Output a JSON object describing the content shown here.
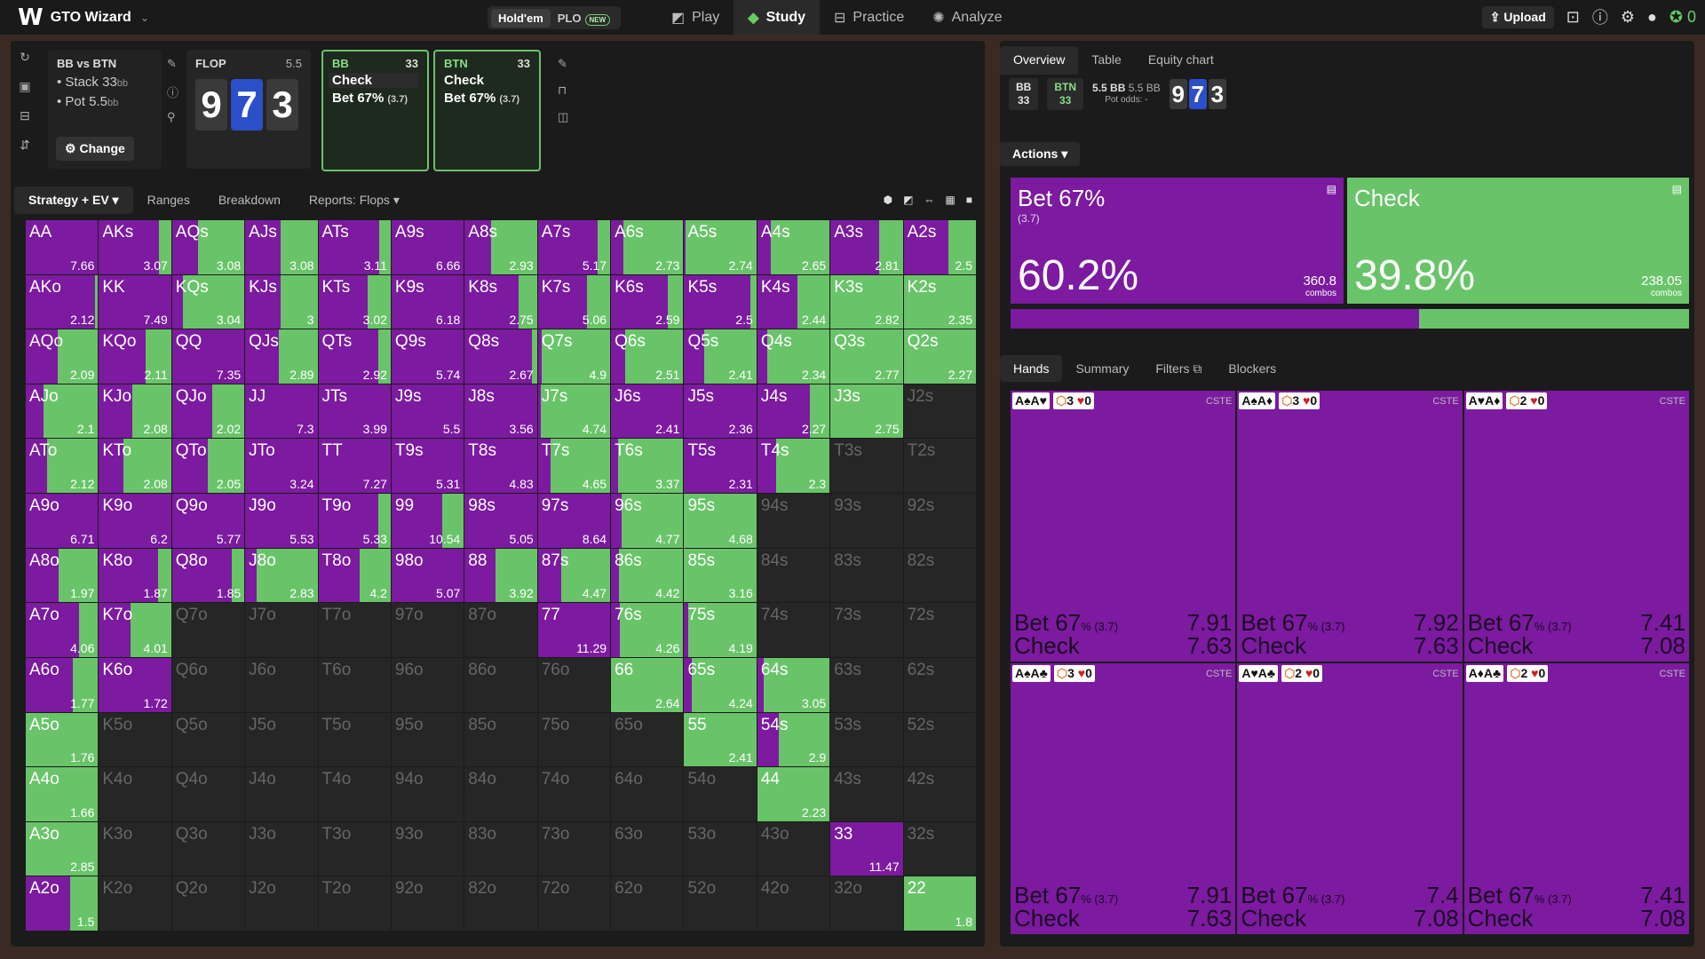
{
  "topbar": {
    "logo_letter": "W",
    "app_title": "GTO Wizard",
    "game_modes": [
      "Hold'em",
      "PLO"
    ],
    "new_badge": "NEW",
    "nav": [
      "Play",
      "Study",
      "Practice",
      "Analyze"
    ],
    "upload_label": "Upload",
    "credits": "0"
  },
  "spot": {
    "title": "BB vs BTN",
    "stack_label": "Stack 33",
    "stack_unit": "bb",
    "pot_label": "Pot 5.5",
    "pot_unit": "bb",
    "change_label": "Change"
  },
  "flop": {
    "label": "FLOP",
    "pot": "5.5",
    "cards": [
      {
        "rank": "9",
        "color": "#3a3a3a"
      },
      {
        "rank": "7",
        "color": "#2b4fc9"
      },
      {
        "rank": "3",
        "color": "#3a3a3a"
      }
    ]
  },
  "action_cards": [
    {
      "player": "BB",
      "stack": "33",
      "lines": [
        {
          "label": "Check",
          "extra": ""
        },
        {
          "label": "Bet 67%",
          "extra": "(3.7)"
        }
      ]
    },
    {
      "player": "BTN",
      "stack": "33",
      "lines": [
        {
          "label": "Check",
          "extra": ""
        },
        {
          "label": "Bet 67%",
          "extra": "(3.7)"
        }
      ]
    }
  ],
  "left_tabs": [
    "Strategy + EV",
    "Ranges",
    "Breakdown",
    "Reports: Flops"
  ],
  "colors": {
    "bet": "#7c1aa0",
    "check": "#69c469",
    "empty": "#262626"
  },
  "matrix": [
    [
      [
        "AA",
        100,
        7.66
      ],
      [
        "AKs",
        83,
        3.07
      ],
      [
        "AQs",
        36,
        3.08
      ],
      [
        "AJs",
        49,
        3.08
      ],
      [
        "ATs",
        84,
        3.11
      ],
      [
        "A9s",
        100,
        6.66
      ],
      [
        "A8s",
        36,
        2.93
      ],
      [
        "A7s",
        83,
        5.17
      ],
      [
        "A6s",
        17,
        2.73
      ],
      [
        "A5s",
        2,
        2.74
      ],
      [
        "A4s",
        19,
        2.65
      ],
      [
        "A3s",
        67,
        2.81
      ],
      [
        "A2s",
        62,
        2.5
      ]
    ],
    [
      [
        "AKo",
        96,
        2.12
      ],
      [
        "KK",
        100,
        7.49
      ],
      [
        "KQs",
        15,
        3.04
      ],
      [
        "KJs",
        49,
        3
      ],
      [
        "KTs",
        68,
        3.02
      ],
      [
        "K9s",
        100,
        6.18
      ],
      [
        "K8s",
        74,
        2.75
      ],
      [
        "K7s",
        68,
        5.06
      ],
      [
        "K6s",
        79,
        2.59
      ],
      [
        "K5s",
        92,
        2.5
      ],
      [
        "K4s",
        56,
        2.44
      ],
      [
        "K3s",
        0,
        2.82
      ],
      [
        "K2s",
        0,
        2.35
      ]
    ],
    [
      [
        "AQo",
        44,
        2.09
      ],
      [
        "KQo",
        65,
        2.11
      ],
      [
        "QQ",
        100,
        7.35
      ],
      [
        "QJs",
        47,
        2.89
      ],
      [
        "QTs",
        83,
        2.92
      ],
      [
        "Q9s",
        100,
        5.74
      ],
      [
        "Q8s",
        93,
        2.67
      ],
      [
        "Q7s",
        5,
        4.9
      ],
      [
        "Q6s",
        19,
        2.51
      ],
      [
        "Q5s",
        28,
        2.41
      ],
      [
        "Q4s",
        14,
        2.34
      ],
      [
        "Q3s",
        0,
        2.77
      ],
      [
        "Q2s",
        0,
        2.27
      ]
    ],
    [
      [
        "AJo",
        25,
        2.1
      ],
      [
        "KJo",
        46,
        2.08
      ],
      [
        "QJo",
        55,
        2.02
      ],
      [
        "JJ",
        100,
        7.3
      ],
      [
        "JTs",
        100,
        3.99
      ],
      [
        "J9s",
        100,
        5.5
      ],
      [
        "J8s",
        100,
        3.56
      ],
      [
        "J7s",
        4,
        4.74
      ],
      [
        "J6s",
        100,
        2.41
      ],
      [
        "J5s",
        100,
        2.36
      ],
      [
        "J4s",
        73,
        2.27
      ],
      [
        "J3s",
        0,
        2.75
      ],
      [
        "J2s",
        -1,
        0
      ]
    ],
    [
      [
        "ATo",
        29,
        2.12
      ],
      [
        "KTo",
        34,
        2.08
      ],
      [
        "QTo",
        50,
        2.05
      ],
      [
        "JTo",
        100,
        3.24
      ],
      [
        "TT",
        100,
        7.27
      ],
      [
        "T9s",
        100,
        5.31
      ],
      [
        "T8s",
        100,
        4.83
      ],
      [
        "T7s",
        17,
        4.65
      ],
      [
        "T6s",
        10,
        3.37
      ],
      [
        "T5s",
        100,
        2.31
      ],
      [
        "T4s",
        26,
        2.3
      ],
      [
        "T3s",
        -1,
        0
      ],
      [
        "T2s",
        -1,
        0
      ]
    ],
    [
      [
        "A9o",
        100,
        6.71
      ],
      [
        "K9o",
        100,
        6.2
      ],
      [
        "Q9o",
        100,
        5.77
      ],
      [
        "J9o",
        100,
        5.53
      ],
      [
        "T9o",
        83,
        5.33
      ],
      [
        "99",
        70,
        10.54
      ],
      [
        "98s",
        100,
        5.05
      ],
      [
        "97s",
        100,
        8.64
      ],
      [
        "96s",
        15,
        4.77
      ],
      [
        "95s",
        0,
        4.68
      ],
      [
        "94s",
        -1,
        0
      ],
      [
        "93s",
        -1,
        0
      ],
      [
        "92s",
        -1,
        0
      ]
    ],
    [
      [
        "A8o",
        45,
        1.97
      ],
      [
        "K8o",
        82,
        1.87
      ],
      [
        "Q8o",
        83,
        1.85
      ],
      [
        "J8o",
        16,
        2.83
      ],
      [
        "T8o",
        57,
        4.2
      ],
      [
        "98o",
        100,
        5.07
      ],
      [
        "88",
        43,
        3.92
      ],
      [
        "87s",
        32,
        4.47
      ],
      [
        "86s",
        11,
        4.42
      ],
      [
        "85s",
        0,
        3.16
      ],
      [
        "84s",
        -1,
        0
      ],
      [
        "83s",
        -1,
        0
      ],
      [
        "82s",
        -1,
        0
      ]
    ],
    [
      [
        "A7o",
        74,
        4.06
      ],
      [
        "K7o",
        44,
        4.01
      ],
      [
        "Q7o",
        -1,
        0
      ],
      [
        "J7o",
        -1,
        0
      ],
      [
        "T7o",
        -1,
        0
      ],
      [
        "97o",
        -1,
        0
      ],
      [
        "87o",
        -1,
        0
      ],
      [
        "77",
        100,
        11.29
      ],
      [
        "76s",
        12,
        4.26
      ],
      [
        "75s",
        6,
        4.19
      ],
      [
        "74s",
        -1,
        0
      ],
      [
        "73s",
        -1,
        0
      ],
      [
        "72s",
        -1,
        0
      ]
    ],
    [
      [
        "A6o",
        65,
        1.77
      ],
      [
        "K6o",
        100,
        1.72
      ],
      [
        "Q6o",
        -1,
        0
      ],
      [
        "J6o",
        -1,
        0
      ],
      [
        "T6o",
        -1,
        0
      ],
      [
        "96o",
        -1,
        0
      ],
      [
        "86o",
        -1,
        0
      ],
      [
        "76o",
        -1,
        0
      ],
      [
        "66",
        0,
        2.64
      ],
      [
        "65s",
        10,
        4.24
      ],
      [
        "64s",
        9,
        3.05
      ],
      [
        "63s",
        -1,
        0
      ],
      [
        "62s",
        -1,
        0
      ]
    ],
    [
      [
        "A5o",
        0,
        1.76
      ],
      [
        "K5o",
        -1,
        0
      ],
      [
        "Q5o",
        -1,
        0
      ],
      [
        "J5o",
        -1,
        0
      ],
      [
        "T5o",
        -1,
        0
      ],
      [
        "95o",
        -1,
        0
      ],
      [
        "85o",
        -1,
        0
      ],
      [
        "75o",
        -1,
        0
      ],
      [
        "65o",
        -1,
        0
      ],
      [
        "55",
        0,
        2.41
      ],
      [
        "54s",
        30,
        2.9
      ],
      [
        "53s",
        -1,
        0
      ],
      [
        "52s",
        -1,
        0
      ]
    ],
    [
      [
        "A4o",
        0,
        1.66
      ],
      [
        "K4o",
        -1,
        0
      ],
      [
        "Q4o",
        -1,
        0
      ],
      [
        "J4o",
        -1,
        0
      ],
      [
        "T4o",
        -1,
        0
      ],
      [
        "94o",
        -1,
        0
      ],
      [
        "84o",
        -1,
        0
      ],
      [
        "74o",
        -1,
        0
      ],
      [
        "64o",
        -1,
        0
      ],
      [
        "54o",
        -1,
        0
      ],
      [
        "44",
        0,
        2.23
      ],
      [
        "43s",
        -1,
        0
      ],
      [
        "42s",
        -1,
        0
      ]
    ],
    [
      [
        "A3o",
        0,
        2.85
      ],
      [
        "K3o",
        -1,
        0
      ],
      [
        "Q3o",
        -1,
        0
      ],
      [
        "J3o",
        -1,
        0
      ],
      [
        "T3o",
        -1,
        0
      ],
      [
        "93o",
        -1,
        0
      ],
      [
        "83o",
        -1,
        0
      ],
      [
        "73o",
        -1,
        0
      ],
      [
        "63o",
        -1,
        0
      ],
      [
        "53o",
        -1,
        0
      ],
      [
        "43o",
        -1,
        0
      ],
      [
        "33",
        100,
        11.47
      ],
      [
        "32s",
        -1,
        0
      ]
    ],
    [
      [
        "A2o",
        61,
        1.5
      ],
      [
        "K2o",
        -1,
        0
      ],
      [
        "Q2o",
        -1,
        0
      ],
      [
        "J2o",
        -1,
        0
      ],
      [
        "T2o",
        -1,
        0
      ],
      [
        "92o",
        -1,
        0
      ],
      [
        "82o",
        -1,
        0
      ],
      [
        "72o",
        -1,
        0
      ],
      [
        "62o",
        -1,
        0
      ],
      [
        "52o",
        -1,
        0
      ],
      [
        "42o",
        -1,
        0
      ],
      [
        "32o",
        -1,
        0
      ],
      [
        "22",
        0,
        1.8
      ]
    ]
  ],
  "right": {
    "tabs": [
      "Overview",
      "Table",
      "Equity chart"
    ],
    "positions": [
      {
        "name": "BB",
        "stack": "33"
      },
      {
        "name": "BTN",
        "stack": "33"
      }
    ],
    "pot_main": "5.5 BB",
    "pot_alt": "5.5 BB",
    "pot_odds_label": "Pot odds:",
    "pot_odds_value": "-",
    "mini_cards": [
      {
        "rank": "9",
        "color": "#3a3a3a"
      },
      {
        "rank": "7",
        "color": "#2b4fc9"
      },
      {
        "rank": "3",
        "color": "#3a3a3a"
      }
    ],
    "actions_label": "Actions",
    "bet": {
      "title": "Bet 67%",
      "sub": "(3.7)",
      "pct": "60.2%",
      "pct_value": 60.2,
      "combos": "360.8",
      "combos_label": "combos"
    },
    "check": {
      "title": "Check",
      "pct": "39.8%",
      "pct_value": 39.8,
      "combos": "238.05",
      "combos_label": "combos"
    },
    "hand_tabs": [
      "Hands",
      "Summary",
      "Filters",
      "Blockers"
    ],
    "hands": [
      {
        "cards": "A♠A♥",
        "badge1": "3",
        "badge2": "0",
        "tag": "CSTE",
        "bet_ev": "7.91",
        "check_ev": "7.63"
      },
      {
        "cards": "A♠A♦",
        "badge1": "3",
        "badge2": "0",
        "tag": "CSTE",
        "bet_ev": "7.92",
        "check_ev": "7.63"
      },
      {
        "cards": "A♥A♦",
        "badge1": "2",
        "badge2": "0",
        "tag": "CSTE",
        "bet_ev": "7.41",
        "check_ev": "7.08"
      },
      {
        "cards": "A♠A♣",
        "badge1": "3",
        "badge2": "0",
        "tag": "CSTE",
        "bet_ev": "7.91",
        "check_ev": "7.63"
      },
      {
        "cards": "A♥A♣",
        "badge1": "2",
        "badge2": "0",
        "tag": "CSTE",
        "bet_ev": "7.4",
        "check_ev": "7.08"
      },
      {
        "cards": "A♦A♣",
        "badge1": "2",
        "badge2": "0",
        "tag": "CSTE",
        "bet_ev": "7.41",
        "check_ev": "7.08"
      }
    ],
    "hand_bet_label": "Bet 67",
    "hand_bet_unit": "% (3.7)",
    "hand_check_label": "Check"
  }
}
